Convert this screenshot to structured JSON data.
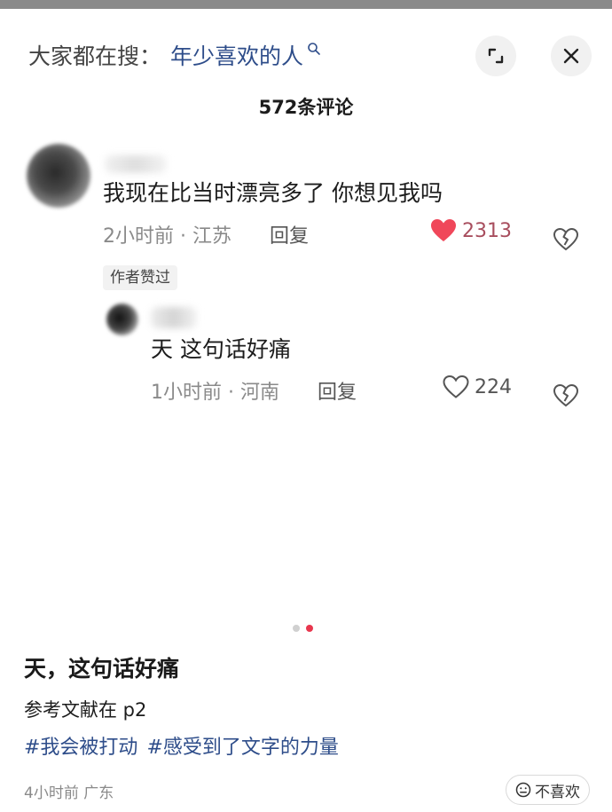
{
  "search": {
    "prefix": "大家都在搜：",
    "term": "年少喜欢的人"
  },
  "comments_header": {
    "count_label": "572条评论"
  },
  "comments": [
    {
      "text": "我现在比当时漂亮多了 你想见我吗",
      "time_location": "2小时前 · 江苏",
      "reply_label": "回复",
      "likes": "2313",
      "liked": true,
      "badge": "作者赞过"
    }
  ],
  "replies": [
    {
      "text": "天 这句话好痛",
      "time_location": "1小时前 · 河南",
      "reply_label": "回复",
      "likes": "224",
      "liked": false
    }
  ],
  "carousel": {
    "count": 2,
    "active_index": 1
  },
  "post": {
    "title": "天，这句话好痛",
    "body": "参考文献在 p2",
    "tags": [
      "#我会被打动",
      "#感受到了文字的力量"
    ],
    "time_location": "4小时前 广东",
    "dislike_label": "不喜欢"
  },
  "colors": {
    "link_blue": "#2e4d8a",
    "like_red": "#f0475a",
    "like_count_red": "#a84e5e",
    "meta_gray": "#8a8a8a",
    "dot_active": "#e8374e",
    "dot_inactive": "#d0d0d0"
  },
  "icons": [
    "search-icon",
    "expand-icon",
    "close-icon",
    "heart-filled-icon",
    "heart-outline-icon",
    "broken-heart-icon",
    "neutral-face-icon"
  ]
}
